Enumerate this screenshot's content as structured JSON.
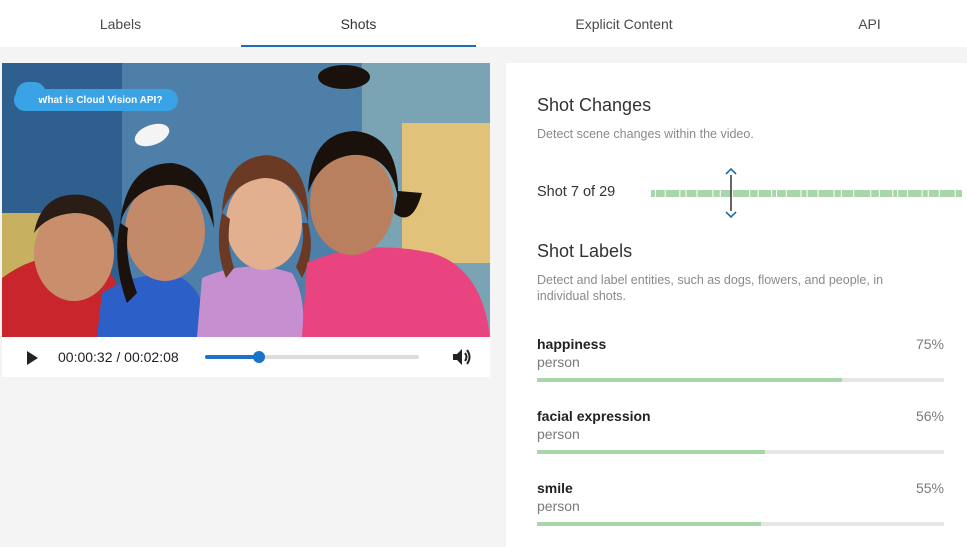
{
  "tabs": [
    {
      "label": "Labels",
      "active": false
    },
    {
      "label": "Shots",
      "active": true
    },
    {
      "label": "Explicit Content",
      "active": false
    },
    {
      "label": "API",
      "active": false
    }
  ],
  "video": {
    "badge_text": "What is Cloud Vision API?",
    "current_time": "00:00:32",
    "separator": " / ",
    "duration": "00:02:08",
    "progress": 0.25,
    "play_icon": "play-icon",
    "volume_icon": "volume-icon"
  },
  "shot_changes": {
    "title": "Shot Changes",
    "description": "Detect scene changes within the video.",
    "shot_text": "Shot 7 of 29",
    "current_shot": 7,
    "total_shots": 29,
    "strip_color": "#a9d6a9",
    "marker_color": "#1f6fb0"
  },
  "shot_labels": {
    "title": "Shot Labels",
    "description": "Detect and label entities, such as dogs, flowers, and people, in individual shots.",
    "items": [
      {
        "name": "happiness",
        "category": "person",
        "percent_text": "75%",
        "value": 0.75
      },
      {
        "name": "facial expression",
        "category": "person",
        "percent_text": "56%",
        "value": 0.56
      },
      {
        "name": "smile",
        "category": "person",
        "percent_text": "55%",
        "value": 0.55
      }
    ],
    "bar_color": "#a7d6a7"
  }
}
